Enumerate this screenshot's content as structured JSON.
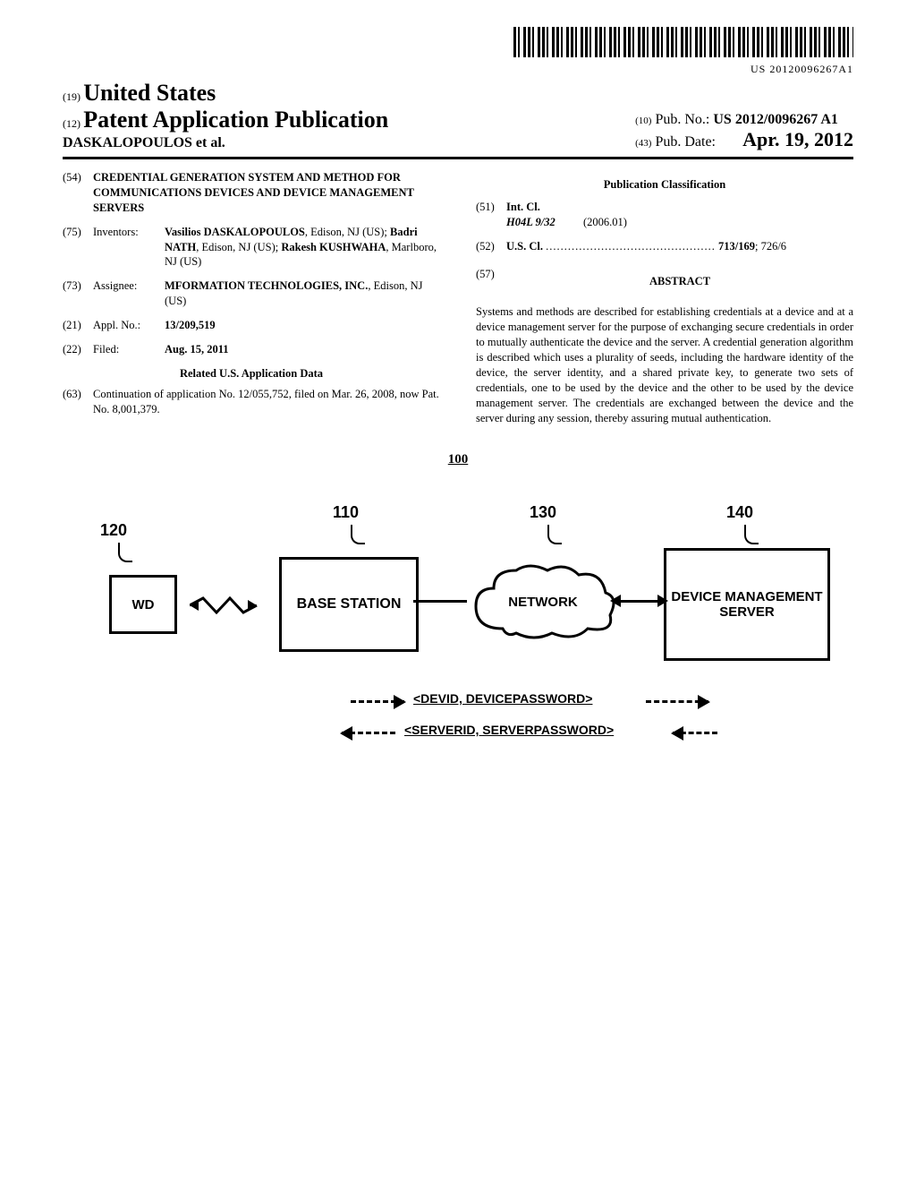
{
  "barcode_number": "US 20120096267A1",
  "header": {
    "country_code": "(19)",
    "country": "United States",
    "pub_type_code": "(12)",
    "pub_type": "Patent Application Publication",
    "authors_line": "DASKALOPOULOS et al.",
    "pub_no_code": "(10)",
    "pub_no_label": "Pub. No.:",
    "pub_no": "US 2012/0096267 A1",
    "pub_date_code": "(43)",
    "pub_date_label": "Pub. Date:",
    "pub_date": "Apr. 19, 2012"
  },
  "left": {
    "title_code": "(54)",
    "title": "CREDENTIAL GENERATION SYSTEM AND METHOD FOR COMMUNICATIONS DEVICES AND DEVICE MANAGEMENT SERVERS",
    "inventors_code": "(75)",
    "inventors_label": "Inventors:",
    "inventors_value_1": "Vasilios DASKALOPOULOS",
    "inventors_value_1b": ", Edison, NJ (US); ",
    "inventors_value_2": "Badri NATH",
    "inventors_value_2b": ", Edison, NJ (US); ",
    "inventors_value_3": "Rakesh KUSHWAHA",
    "inventors_value_3b": ", Marlboro, NJ (US)",
    "assignee_code": "(73)",
    "assignee_label": "Assignee:",
    "assignee_value_1": "MFORMATION TECHNOLOGIES, INC.",
    "assignee_value_2": ", Edison, NJ (US)",
    "appl_code": "(21)",
    "appl_label": "Appl. No.:",
    "appl_value": "13/209,519",
    "filed_code": "(22)",
    "filed_label": "Filed:",
    "filed_value": "Aug. 15, 2011",
    "related_heading": "Related U.S. Application Data",
    "cont_code": "(63)",
    "cont_value": "Continuation of application No. 12/055,752, filed on Mar. 26, 2008, now Pat. No. 8,001,379."
  },
  "right": {
    "pub_class_heading": "Publication Classification",
    "intcl_code": "(51)",
    "intcl_label": "Int. Cl.",
    "intcl_symbol": "H04L 9/32",
    "intcl_date": "(2006.01)",
    "uscl_code": "(52)",
    "uscl_label": "U.S. Cl.",
    "uscl_dots": "..............................................",
    "uscl_main": "713/169",
    "uscl_rest": "; 726/6",
    "abstract_code": "(57)",
    "abstract_heading": "ABSTRACT",
    "abstract_text": "Systems and methods are described for establishing credentials at a device and at a device management server for the purpose of exchanging secure credentials in order to mutually authenticate the device and the server. A credential generation algorithm is described which uses a plurality of seeds, including the hardware identity of the device, the server identity, and a shared private key, to generate two sets of credentials, one to be used by the device and the other to be used by the device management server. The credentials are exchanged between the device and the server during any session, thereby assuring mutual authentication."
  },
  "figure": {
    "ref_main": "100",
    "ref_wd": "120",
    "ref_base": "110",
    "ref_net": "130",
    "ref_server": "140",
    "box_wd": "WD",
    "box_base": "BASE STATION",
    "cloud": "NETWORK",
    "box_server": "DEVICE MANAGEMENT SERVER",
    "cred1": "<DEVID, DEVICEPASSWORD>",
    "cred2": "<SERVERID, SERVERPASSWORD>"
  }
}
